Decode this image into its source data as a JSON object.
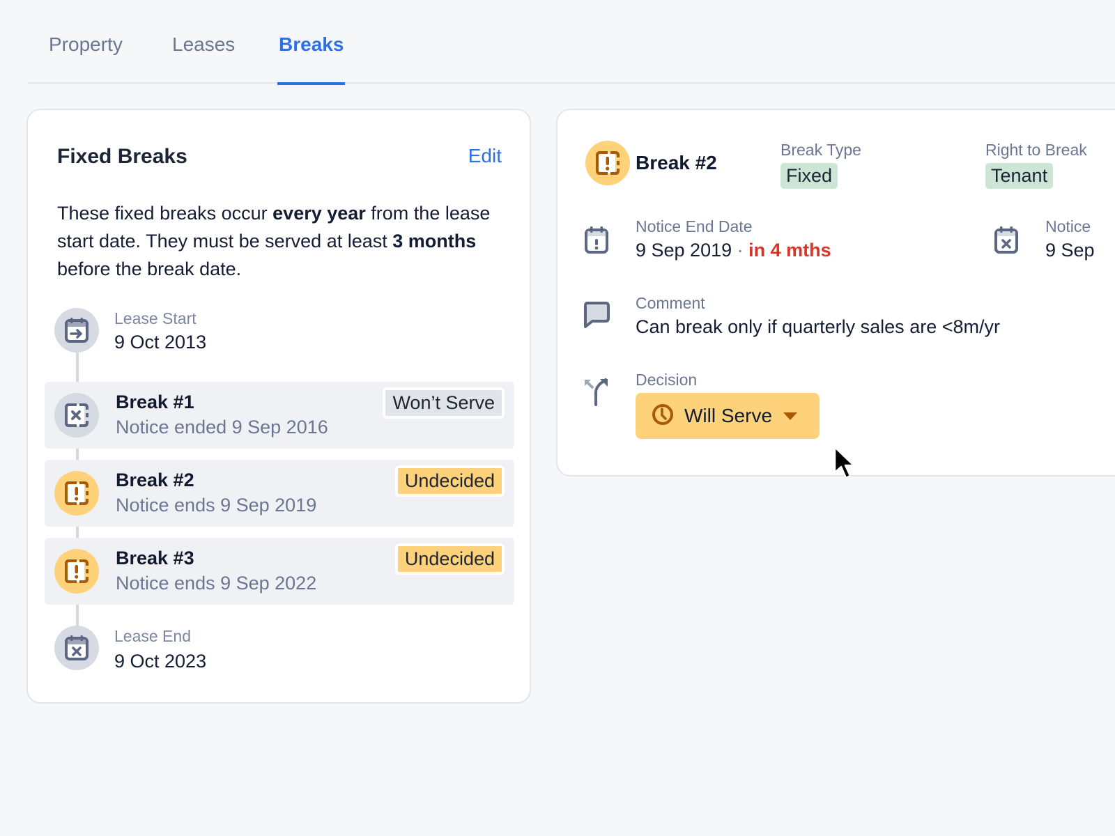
{
  "tabs": [
    {
      "label": "Property",
      "active": false
    },
    {
      "label": "Leases",
      "active": false
    },
    {
      "label": "Breaks",
      "active": true
    }
  ],
  "fixed_breaks": {
    "title": "Fixed Breaks",
    "edit_label": "Edit",
    "description": {
      "part1": "These fixed breaks occur ",
      "bold1": "every year",
      "part2": " from the lease start date. They must be served at least ",
      "bold2": "3 months",
      "part3": " before the break date."
    },
    "timeline": {
      "lease_start": {
        "label": "Lease Start",
        "date": "9 Oct 2013",
        "icon": "calendar-arrow-icon"
      },
      "breaks": [
        {
          "title": "Break #1",
          "subtitle": "Notice ended 9 Sep 2016",
          "status": "Won’t Serve",
          "status_color": "#e1e4e9",
          "icon": "break-cross-icon"
        },
        {
          "title": "Break #2",
          "subtitle": "Notice ends 9 Sep 2019",
          "status": "Undecided",
          "status_color": "#fdd27a",
          "icon": "break-alert-icon"
        },
        {
          "title": "Break #3",
          "subtitle": "Notice ends 9 Sep 2022",
          "status": "Undecided",
          "status_color": "#fdd27a",
          "icon": "break-alert-icon"
        }
      ],
      "lease_end": {
        "label": "Lease End",
        "date": "9 Oct 2023",
        "icon": "calendar-x-icon"
      }
    }
  },
  "break_detail": {
    "title": "Break #2",
    "break_type": {
      "label": "Break Type",
      "value": "Fixed"
    },
    "right_to_break": {
      "label": "Right to Break",
      "value": "Tenant"
    },
    "notice_end_date": {
      "label": "Notice End Date",
      "date": "9 Sep 2019",
      "separator": "·",
      "relative": "in 4 mths"
    },
    "notice_partial": {
      "label": "Notice",
      "value": "9 Sep"
    },
    "comment": {
      "label": "Comment",
      "value": "Can break only if quarterly sales are <8m/yr"
    },
    "decision": {
      "label": "Decision",
      "selected": "Will Serve",
      "icon": "clock-icon"
    }
  },
  "colors": {
    "accent": "#2f6fe0",
    "warning": "#fdd27a",
    "warning_dark": "#a85a06",
    "urgent": "#d6362a",
    "success_bg": "#cde5d4",
    "muted": "#6b7693"
  }
}
